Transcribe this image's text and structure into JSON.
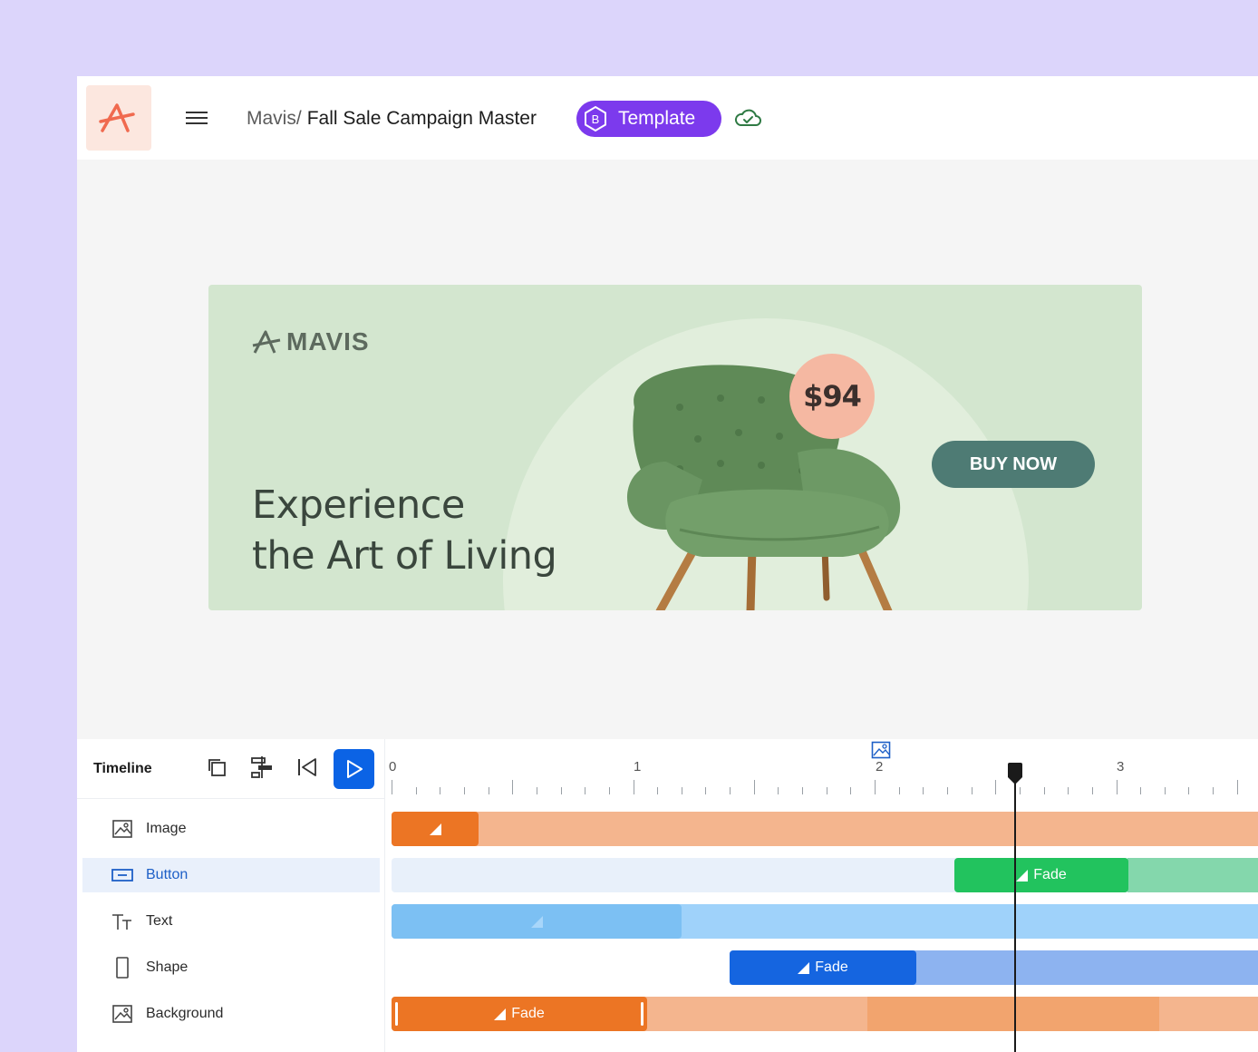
{
  "header": {
    "breadcrumb_root": "Mavis/",
    "document_title": "Fall Sale Campaign Master",
    "badge_label": "Template",
    "badge_icon": "hexagon-b-icon",
    "status_icon": "cloud-check-icon",
    "accent_color": "#7c3aed",
    "logo_color": "#f06a4f"
  },
  "banner": {
    "brand_name": "MAVIS",
    "headline_line1": "Experience",
    "headline_line2": "the Art of Living",
    "price": "$94",
    "cta_label": "BUY NOW",
    "background_color": "#d3e6cf",
    "cta_color": "#4e7b74",
    "price_color": "#f5b8a2"
  },
  "timeline": {
    "title": "Timeline",
    "tools": [
      "duplicate-icon",
      "align-icon",
      "skip-to-start-icon",
      "play-icon"
    ],
    "ruler_labels": [
      "0",
      "1",
      "2",
      "3"
    ],
    "layers": [
      {
        "label": "Image",
        "icon": "image-icon",
        "selected": false
      },
      {
        "label": "Button",
        "icon": "button-icon",
        "selected": true
      },
      {
        "label": "Text",
        "icon": "text-icon",
        "selected": false
      },
      {
        "label": "Shape",
        "icon": "shape-icon",
        "selected": false
      },
      {
        "label": "Background",
        "icon": "image-icon",
        "selected": false
      }
    ],
    "clip_labels": {
      "button": "Fade",
      "shape": "Fade",
      "background": "Fade"
    },
    "colors": {
      "orange": "#ec7524",
      "orange_light": "#f4b58e",
      "green": "#22c35e",
      "green_light": "#84d7ac",
      "blue": "#1565e0",
      "blue_light": "#8db3f0",
      "sky": "#7cc0f3",
      "sky_light": "#9fd2fa",
      "pale_blue": "#e8f0fa"
    }
  }
}
